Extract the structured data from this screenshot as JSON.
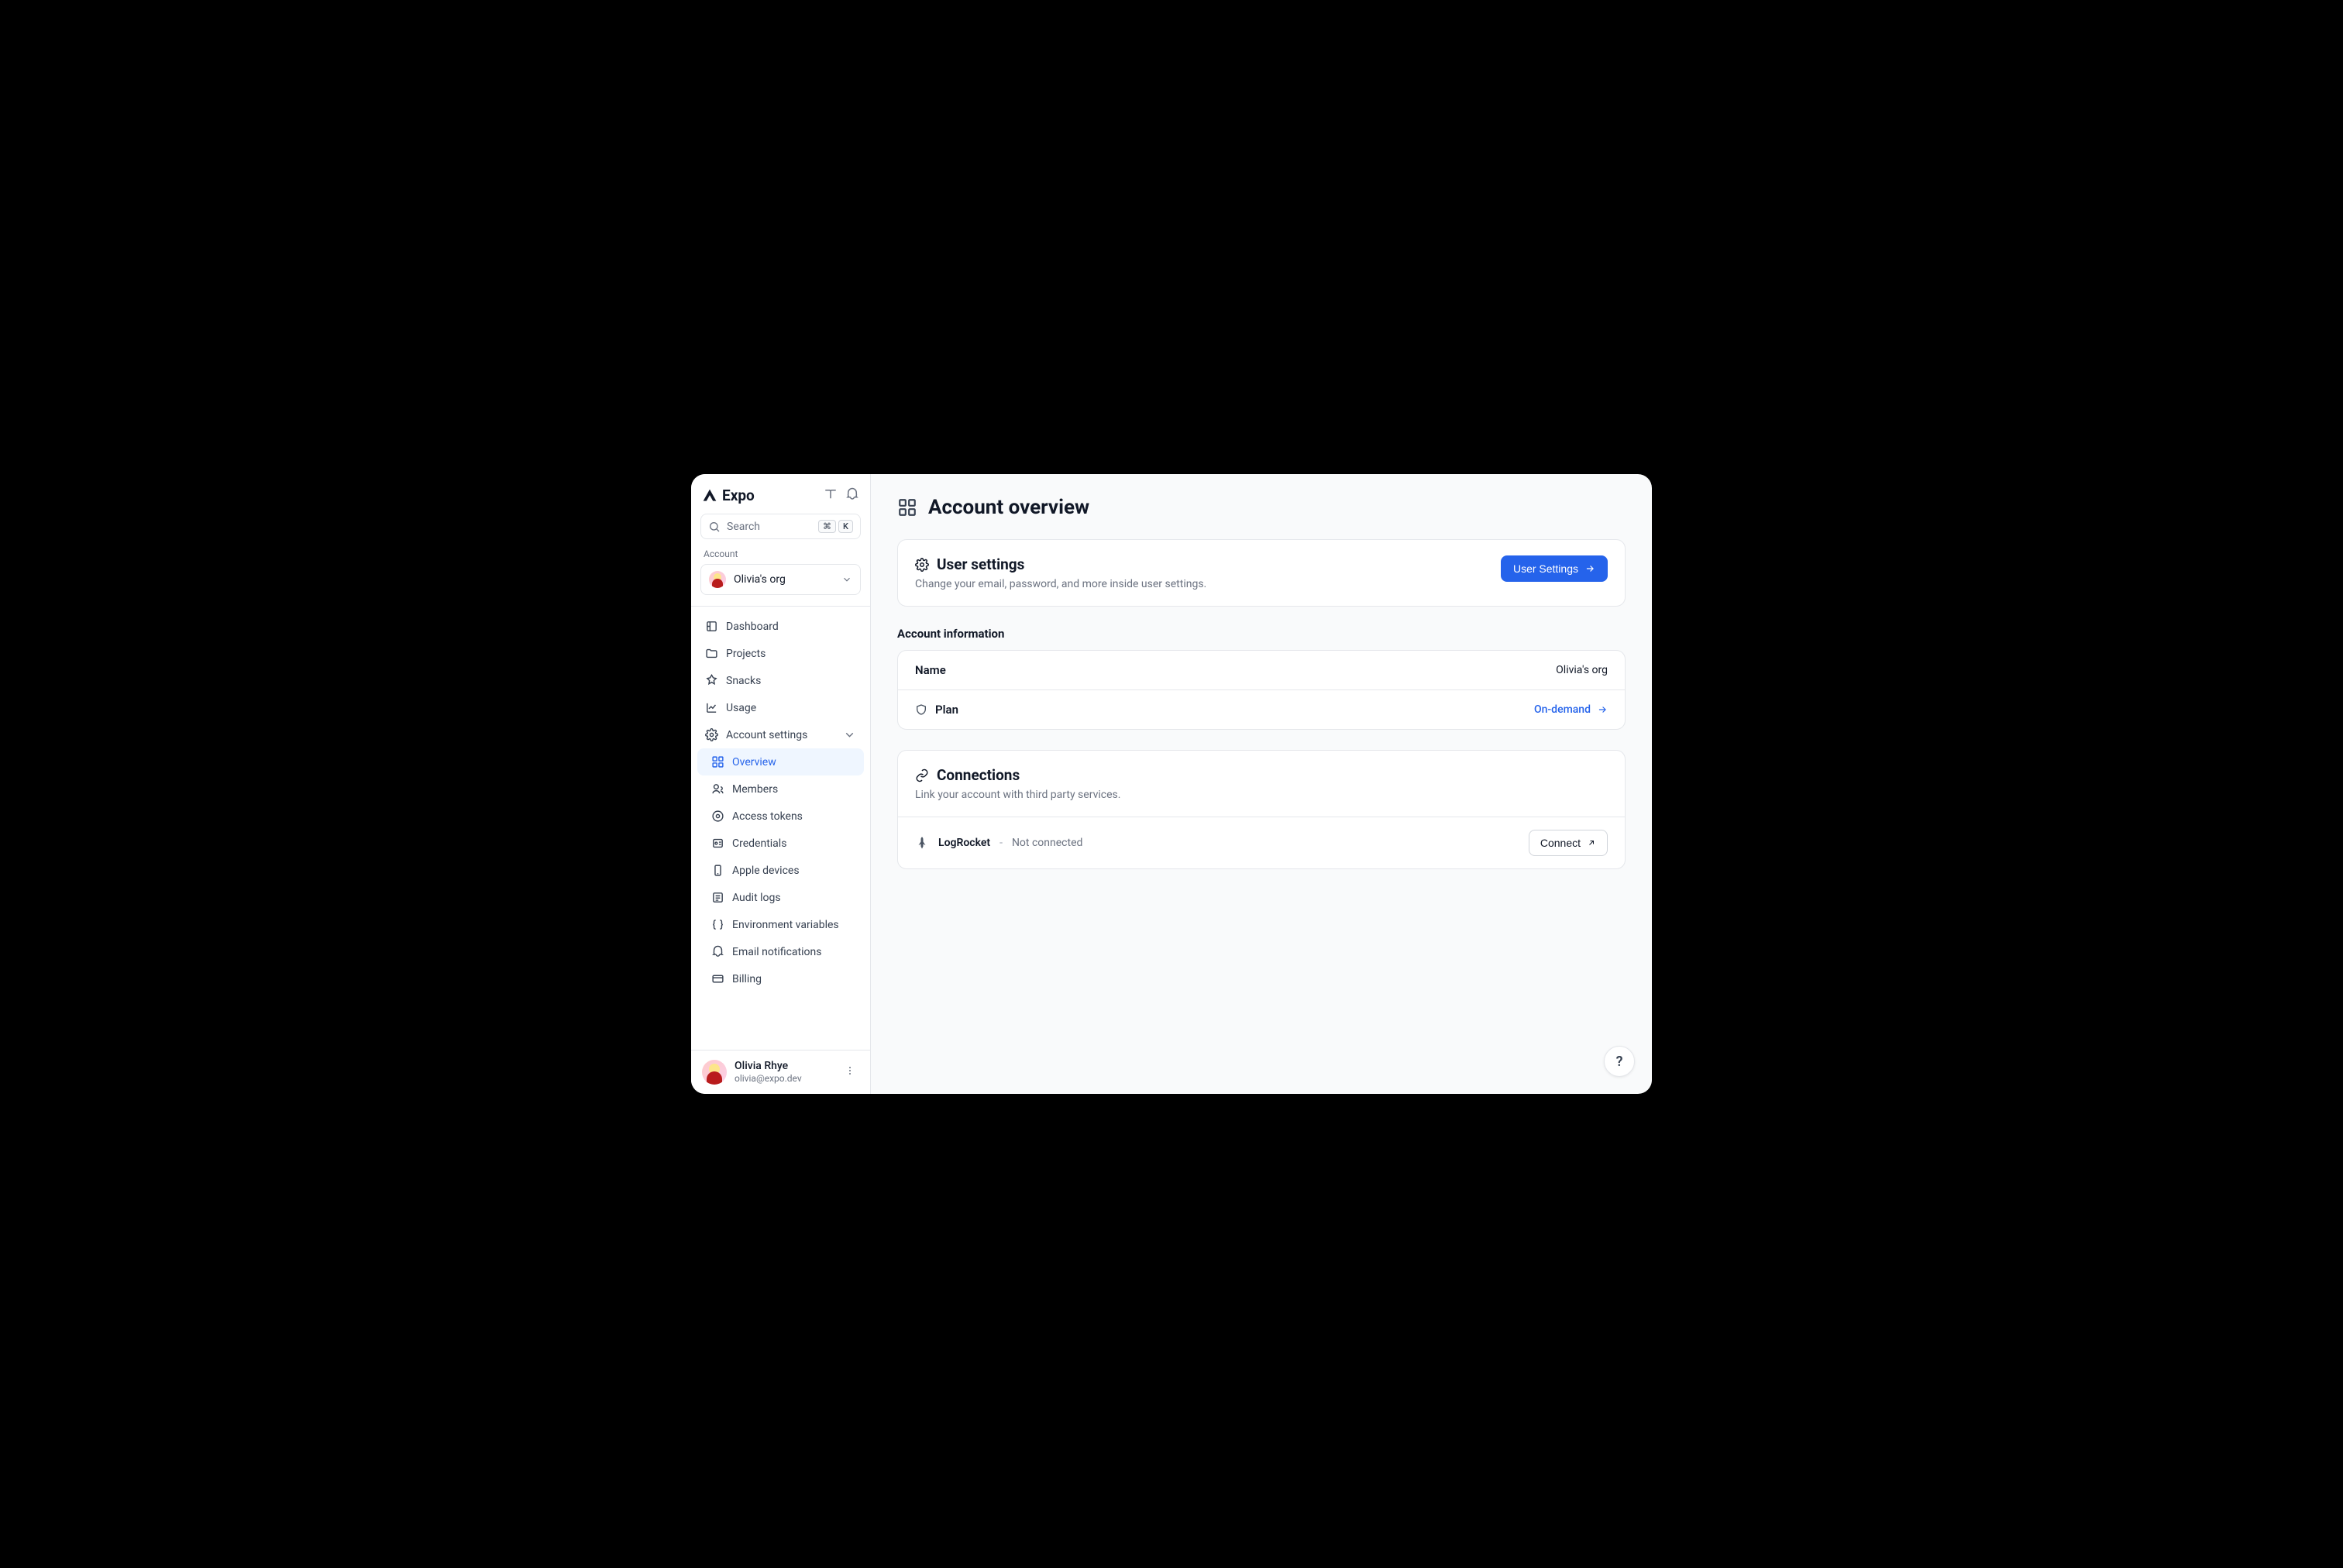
{
  "brand": "Expo",
  "search": {
    "placeholder": "Search",
    "shortcut1": "⌘",
    "shortcut2": "K"
  },
  "account_section_label": "Account",
  "org": {
    "name": "Olivia's org"
  },
  "nav": {
    "dashboard": "Dashboard",
    "projects": "Projects",
    "snacks": "Snacks",
    "usage": "Usage",
    "account_settings": "Account settings",
    "sub": {
      "overview": "Overview",
      "members": "Members",
      "access_tokens": "Access tokens",
      "credentials": "Credentials",
      "apple_devices": "Apple devices",
      "audit_logs": "Audit logs",
      "env_vars": "Environment variables",
      "email_notifications": "Email notifications",
      "billing": "Billing"
    }
  },
  "user": {
    "name": "Olivia Rhye",
    "email": "olivia@expo.dev"
  },
  "page": {
    "title": "Account overview",
    "user_settings": {
      "title": "User settings",
      "subtitle": "Change your email, password, and more inside user settings.",
      "button": "User Settings"
    },
    "account_info": {
      "heading": "Account information",
      "name_label": "Name",
      "name_value": "Olivia's org",
      "plan_label": "Plan",
      "plan_value": "On-demand"
    },
    "connections": {
      "title": "Connections",
      "subtitle": "Link your account with third party services.",
      "logrocket": {
        "name": "LogRocket",
        "status": "Not connected",
        "button": "Connect"
      }
    }
  },
  "help_symbol": "?"
}
